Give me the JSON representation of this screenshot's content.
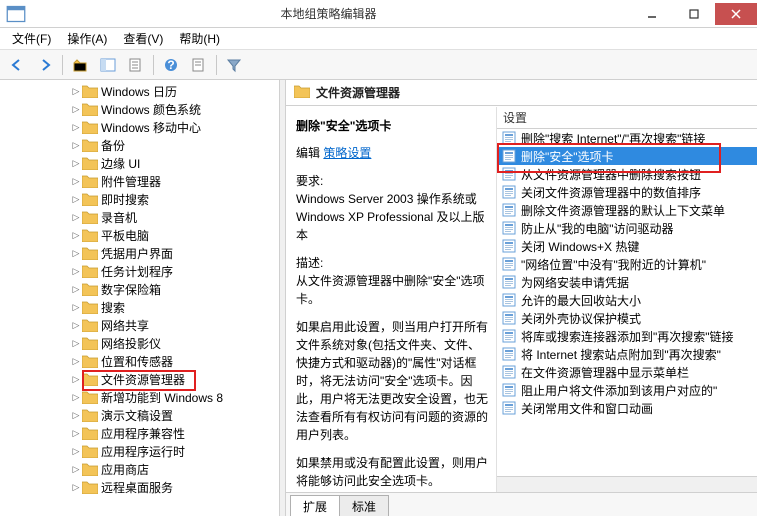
{
  "titlebar": {
    "title": "本地组策略编辑器"
  },
  "menubar": {
    "file": "文件(F)",
    "action": "操作(A)",
    "view": "查看(V)",
    "help": "帮助(H)"
  },
  "tree": {
    "items": [
      {
        "label": "Windows 日历"
      },
      {
        "label": "Windows 颜色系统"
      },
      {
        "label": "Windows 移动中心"
      },
      {
        "label": "备份"
      },
      {
        "label": "边缘 UI"
      },
      {
        "label": "附件管理器"
      },
      {
        "label": "即时搜索"
      },
      {
        "label": "录音机"
      },
      {
        "label": "平板电脑"
      },
      {
        "label": "凭据用户界面"
      },
      {
        "label": "任务计划程序"
      },
      {
        "label": "数字保险箱"
      },
      {
        "label": "搜索"
      },
      {
        "label": "网络共享"
      },
      {
        "label": "网络投影仪"
      },
      {
        "label": "位置和传感器"
      },
      {
        "label": "文件资源管理器",
        "highlighted": true
      },
      {
        "label": "新增功能到 Windows 8"
      },
      {
        "label": "演示文稿设置"
      },
      {
        "label": "应用程序兼容性"
      },
      {
        "label": "应用程序运行时"
      },
      {
        "label": "应用商店"
      },
      {
        "label": "远程桌面服务"
      }
    ]
  },
  "right": {
    "header_title": "文件资源管理器",
    "desc": {
      "title": "删除\"安全\"选项卡",
      "edit_label": "编辑",
      "edit_link": "策略设置",
      "req_label": "要求:",
      "req_text": "Windows Server 2003 操作系统或 Windows XP Professional 及以上版本",
      "desc_label": "描述:",
      "desc_text": "从文件资源管理器中删除\"安全\"选项卡。",
      "para1": "如果启用此设置，则当用户打开所有文件系统对象(包括文件夹、文件、快捷方式和驱动器)的\"属性\"对话框时，将无法访问\"安全\"选项卡。因此，用户将无法更改安全设置，也无法查看所有有权访问有问题的资源的用户列表。",
      "para2": "如果禁用或没有配置此设置，则用户将能够访问此安全选项卡。"
    },
    "list_header": "设置",
    "settings": [
      {
        "label": "删除\"搜索 Internet\"/\"再次搜索\"链接"
      },
      {
        "label": "删除\"安全\"选项卡",
        "selected": true,
        "highlighted": true
      },
      {
        "label": "从文件资源管理器中删除搜索按钮"
      },
      {
        "label": "关闭文件资源管理器中的数值排序"
      },
      {
        "label": "删除文件资源管理器的默认上下文菜单"
      },
      {
        "label": "防止从\"我的电脑\"访问驱动器"
      },
      {
        "label": "关闭 Windows+X 热键"
      },
      {
        "label": "\"网络位置\"中没有\"我附近的计算机\""
      },
      {
        "label": "为网络安装申请凭据"
      },
      {
        "label": "允许的最大回收站大小"
      },
      {
        "label": "关闭外壳协议保护模式"
      },
      {
        "label": "将库或搜索连接器添加到\"再次搜索\"链接"
      },
      {
        "label": "将 Internet 搜索站点附加到\"再次搜索\""
      },
      {
        "label": "在文件资源管理器中显示菜单栏"
      },
      {
        "label": "阻止用户将文件添加到该用户对应的\""
      },
      {
        "label": "关闭常用文件和窗口动画"
      }
    ],
    "tabs": {
      "extended": "扩展",
      "standard": "标准"
    }
  }
}
